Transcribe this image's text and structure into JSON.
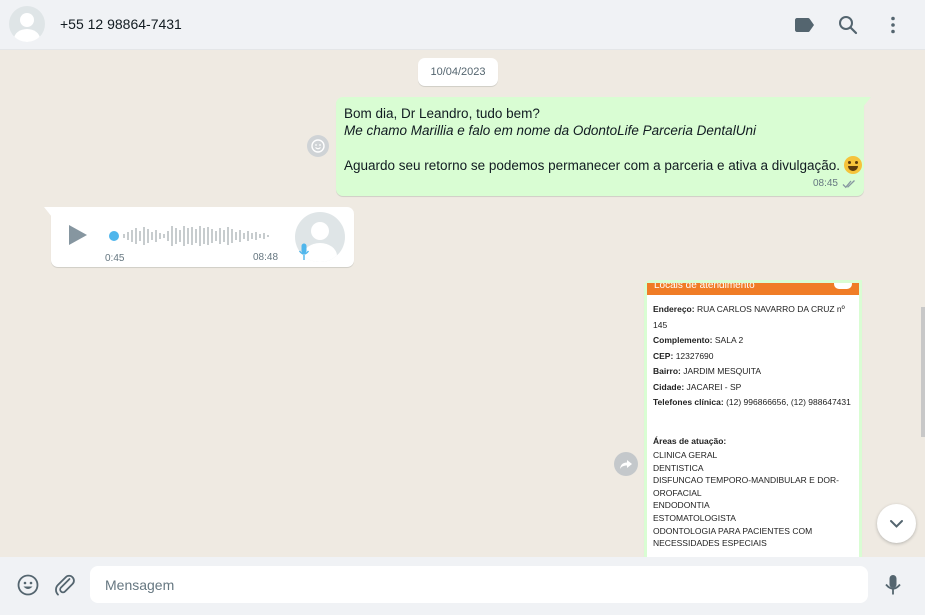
{
  "header": {
    "contact_name": "+55 12 98864-7431",
    "icons": [
      "label-icon",
      "search-icon",
      "more-options-icon"
    ]
  },
  "chat": {
    "date_chip": "10/04/2023",
    "outgoing_message": {
      "lines": [
        "Bom dia, Dr Leandro, tudo bem?",
        "Me chamo Marillia e falo em nome da OdontoLife Parceria DentalUni",
        "Aguardo seu retorno se podemos permanecer com a parceria e ativa a divulgação."
      ],
      "time": "08:45",
      "status": "read"
    },
    "voice_message": {
      "duration": "0:45",
      "time": "08:48",
      "progress": 0
    },
    "image_message": {
      "header_title": "Locais de atendimento",
      "fields": [
        {
          "label": "Endereço:",
          "value": "RUA CARLOS NAVARRO DA CRUZ nº 145"
        },
        {
          "label": "Complemento:",
          "value": "SALA 2"
        },
        {
          "label": "CEP:",
          "value": "12327690"
        },
        {
          "label": "Bairro:",
          "value": "JARDIM MESQUITA"
        },
        {
          "label": "Cidade:",
          "value": "JACAREI - SP"
        },
        {
          "label": "Telefones clínica:",
          "value": "(12) 996866656, (12) 988647431"
        }
      ],
      "areas_title": "Áreas de atuação:",
      "areas": [
        "CLINICA GERAL",
        "DENTISTICA",
        "DISFUNCAO TEMPORO-MANDIBULAR E DOR-",
        "OROFACIAL",
        "ENDODONTIA",
        "ESTOMATOLOGISTA",
        "ODONTOLOGIA PARA PACIENTES COM",
        "NECESSIDADES ESPECIAIS"
      ]
    }
  },
  "footer": {
    "composer_placeholder": "Mensagem",
    "icons": [
      "emoji-icon",
      "attach-icon",
      "microphone-icon"
    ]
  },
  "colors": {
    "outgoing_bubble": "#d9fdd3",
    "incoming_bubble": "#ffffff",
    "chat_background": "#efeae2",
    "read_ticks": "#8696a0",
    "doc_header": "#f07c26"
  }
}
